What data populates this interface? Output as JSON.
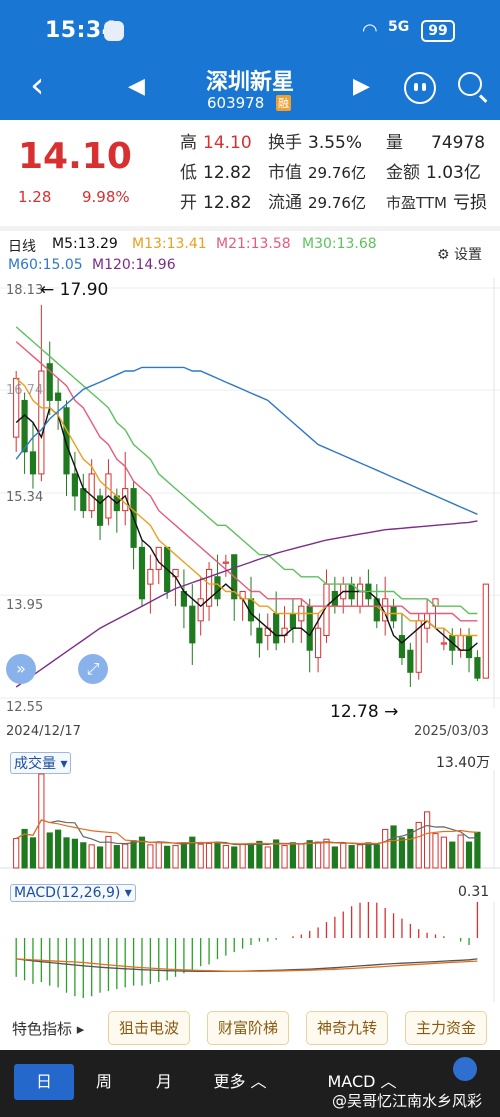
{
  "status": {
    "time": "15:34",
    "signal": "5G",
    "battery": "99"
  },
  "header": {
    "name": "深圳新星",
    "code": "603978",
    "badge": "融"
  },
  "quote": {
    "price": "14.10",
    "change": "1.28",
    "change_pct": "9.98%",
    "rows": [
      [
        {
          "k": "高",
          "v": "14.10"
        },
        {
          "k": "换手",
          "v": "3.55%"
        },
        {
          "k": "量",
          "v": "74978"
        }
      ],
      [
        {
          "k": "低",
          "v": "12.82"
        },
        {
          "k": "市值",
          "v": "29.76亿"
        },
        {
          "k": "金额",
          "v": "1.03亿"
        }
      ],
      [
        {
          "k": "开",
          "v": "12.82"
        },
        {
          "k": "流通",
          "v": "29.76亿"
        },
        {
          "k": "市盈TTM",
          "v": "亏损"
        }
      ]
    ]
  },
  "ma_legend": {
    "period": "日线",
    "ma5": "M5:13.29",
    "ma13": "M13:13.41",
    "ma21": "M21:13.58",
    "ma30": "M30:13.68",
    "ma60": "M60:15.05",
    "ma120": "M120:14.96",
    "settings": "设置",
    "colors": {
      "ma5": "#111111",
      "ma13": "#e8a020",
      "ma21": "#e85a7a",
      "ma30": "#5ec15e",
      "ma60": "#2f78c8",
      "ma120": "#7b2d88"
    }
  },
  "price_axis": {
    "labels": [
      "18.13",
      "15.34",
      "13.95",
      "12.55"
    ],
    "partial": "16.74"
  },
  "dates": {
    "start": "2024/12/17",
    "end": "2025/03/03"
  },
  "annotations": {
    "high": "17.90",
    "low": "12.78"
  },
  "volume": {
    "label": "成交量",
    "max": "13.40万"
  },
  "macd": {
    "label": "MACD(12,26,9)",
    "max": "0.31"
  },
  "features": {
    "label": "特色指标",
    "buttons": [
      "狙击电波",
      "财富阶梯",
      "神奇九转",
      "主力资金"
    ]
  },
  "bottom_tabs": {
    "day": "日",
    "week": "周",
    "month": "月",
    "more": "更多",
    "indicator": "MACD"
  },
  "watermark": "@吴哥忆江南水乡风彩",
  "chart_data": {
    "type": "candlestick",
    "y_range": [
      12.55,
      18.13
    ],
    "candles": [
      {
        "o": 16.1,
        "c": 16.9,
        "h": 17.0,
        "l": 15.9
      },
      {
        "o": 16.6,
        "c": 15.9,
        "h": 16.7,
        "l": 15.6
      },
      {
        "o": 15.9,
        "c": 15.6,
        "h": 16.3,
        "l": 15.4
      },
      {
        "o": 15.6,
        "c": 17.0,
        "h": 17.9,
        "l": 15.5
      },
      {
        "o": 17.1,
        "c": 16.6,
        "h": 17.4,
        "l": 16.4
      },
      {
        "o": 16.7,
        "c": 16.6,
        "h": 16.9,
        "l": 16.2
      },
      {
        "o": 16.5,
        "c": 15.6,
        "h": 16.6,
        "l": 15.3
      },
      {
        "o": 15.6,
        "c": 15.3,
        "h": 15.9,
        "l": 15.1
      },
      {
        "o": 15.4,
        "c": 15.1,
        "h": 15.6,
        "l": 15.0
      },
      {
        "o": 15.1,
        "c": 15.6,
        "h": 15.8,
        "l": 15.0
      },
      {
        "o": 15.3,
        "c": 14.9,
        "h": 15.4,
        "l": 14.7
      },
      {
        "o": 15.0,
        "c": 15.6,
        "h": 15.8,
        "l": 14.9
      },
      {
        "o": 15.3,
        "c": 15.1,
        "h": 15.4,
        "l": 14.8
      },
      {
        "o": 15.1,
        "c": 15.4,
        "h": 15.9,
        "l": 14.9
      },
      {
        "o": 15.4,
        "c": 14.6,
        "h": 15.5,
        "l": 14.3
      },
      {
        "o": 14.6,
        "c": 13.9,
        "h": 14.7,
        "l": 13.8
      },
      {
        "o": 14.1,
        "c": 14.3,
        "h": 14.5,
        "l": 13.7
      },
      {
        "o": 14.3,
        "c": 14.6,
        "h": 14.6,
        "l": 14.1
      },
      {
        "o": 14.6,
        "c": 14.0,
        "h": 14.6,
        "l": 13.9
      },
      {
        "o": 14.2,
        "c": 14.3,
        "h": 14.3,
        "l": 13.8
      },
      {
        "o": 14.0,
        "c": 13.8,
        "h": 14.3,
        "l": 13.5
      },
      {
        "o": 13.8,
        "c": 13.3,
        "h": 14.1,
        "l": 13.0
      },
      {
        "o": 13.6,
        "c": 13.9,
        "h": 14.2,
        "l": 13.4
      },
      {
        "o": 13.8,
        "c": 14.3,
        "h": 14.4,
        "l": 13.6
      },
      {
        "o": 14.2,
        "c": 13.9,
        "h": 14.5,
        "l": 13.8
      },
      {
        "o": 14.4,
        "c": 14.4,
        "h": 14.5,
        "l": 14.2
      },
      {
        "o": 14.5,
        "c": 13.9,
        "h": 14.5,
        "l": 13.6
      },
      {
        "o": 13.9,
        "c": 14.0,
        "h": 14.0,
        "l": 13.6
      },
      {
        "o": 13.9,
        "c": 13.6,
        "h": 14.2,
        "l": 13.4
      },
      {
        "o": 13.5,
        "c": 13.3,
        "h": 13.7,
        "l": 13.1
      },
      {
        "o": 13.4,
        "c": 13.5,
        "h": 13.7,
        "l": 13.2
      },
      {
        "o": 13.7,
        "c": 13.3,
        "h": 14.0,
        "l": 13.2
      },
      {
        "o": 13.4,
        "c": 13.5,
        "h": 13.8,
        "l": 13.3
      },
      {
        "o": 13.7,
        "c": 13.5,
        "h": 13.9,
        "l": 13.3
      },
      {
        "o": 13.6,
        "c": 13.8,
        "h": 13.9,
        "l": 13.3
      },
      {
        "o": 13.8,
        "c": 13.2,
        "h": 13.9,
        "l": 12.9
      },
      {
        "o": 13.1,
        "c": 13.5,
        "h": 13.7,
        "l": 12.9
      },
      {
        "o": 13.4,
        "c": 14.1,
        "h": 14.3,
        "l": 13.3
      },
      {
        "o": 14.0,
        "c": 13.8,
        "h": 14.2,
        "l": 13.7
      },
      {
        "o": 13.9,
        "c": 14.1,
        "h": 14.2,
        "l": 13.7
      },
      {
        "o": 14.1,
        "c": 13.9,
        "h": 14.2,
        "l": 13.8
      },
      {
        "o": 13.8,
        "c": 14.1,
        "h": 14.2,
        "l": 13.7
      },
      {
        "o": 14.1,
        "c": 13.9,
        "h": 14.3,
        "l": 13.8
      },
      {
        "o": 13.9,
        "c": 13.6,
        "h": 14.1,
        "l": 13.5
      },
      {
        "o": 13.6,
        "c": 13.9,
        "h": 14.2,
        "l": 13.4
      },
      {
        "o": 13.8,
        "c": 13.6,
        "h": 13.9,
        "l": 13.5
      },
      {
        "o": 13.4,
        "c": 13.1,
        "h": 13.7,
        "l": 13.0
      },
      {
        "o": 13.2,
        "c": 12.9,
        "h": 13.3,
        "l": 12.7
      },
      {
        "o": 12.9,
        "c": 13.6,
        "h": 13.7,
        "l": 12.8
      },
      {
        "o": 13.5,
        "c": 13.7,
        "h": 13.9,
        "l": 13.3
      },
      {
        "o": 13.8,
        "c": 13.9,
        "h": 13.9,
        "l": 13.5
      },
      {
        "o": 13.3,
        "c": 13.3,
        "h": 13.5,
        "l": 13.2
      },
      {
        "o": 13.4,
        "c": 13.2,
        "h": 13.5,
        "l": 13.0
      },
      {
        "o": 13.2,
        "c": 13.4,
        "h": 13.5,
        "l": 13.1
      },
      {
        "o": 13.4,
        "c": 13.1,
        "h": 13.5,
        "l": 12.9
      },
      {
        "o": 13.1,
        "c": 12.82,
        "h": 13.2,
        "l": 12.78
      },
      {
        "o": 12.82,
        "c": 14.1,
        "h": 14.1,
        "l": 12.82
      }
    ],
    "ma": {
      "ma5": [
        16.3,
        16.4,
        16.3,
        16.1,
        16.5,
        16.4,
        16.0,
        15.7,
        15.4,
        15.3,
        15.2,
        15.3,
        15.2,
        15.3,
        15.0,
        14.7,
        14.6,
        14.4,
        14.3,
        14.2,
        14.0,
        13.9,
        13.8,
        13.9,
        14.0,
        14.1,
        14.0,
        13.9,
        13.7,
        13.6,
        13.5,
        13.4,
        13.4,
        13.5,
        13.5,
        13.4,
        13.6,
        13.8,
        13.9,
        14.0,
        14.0,
        14.0,
        14.0,
        13.9,
        13.7,
        13.4,
        13.3,
        13.4,
        13.5,
        13.6,
        13.5,
        13.4,
        13.3,
        13.2,
        13.2,
        13.3
      ],
      "ma13": [
        16.9,
        16.8,
        16.6,
        16.5,
        16.5,
        16.4,
        16.2,
        16.0,
        15.8,
        15.7,
        15.5,
        15.4,
        15.3,
        15.2,
        15.1,
        15.0,
        14.9,
        14.7,
        14.6,
        14.5,
        14.4,
        14.3,
        14.2,
        14.1,
        14.1,
        14.0,
        14.0,
        13.9,
        13.9,
        13.8,
        13.8,
        13.7,
        13.7,
        13.7,
        13.7,
        13.7,
        13.7,
        13.8,
        13.8,
        13.8,
        13.8,
        13.8,
        13.8,
        13.8,
        13.7,
        13.7,
        13.7,
        13.6,
        13.6,
        13.6,
        13.5,
        13.5,
        13.4,
        13.4,
        13.4,
        13.4
      ],
      "ma21": [
        17.4,
        17.3,
        17.2,
        17.1,
        17.0,
        16.9,
        16.8,
        16.6,
        16.5,
        16.3,
        16.1,
        16.0,
        15.8,
        15.7,
        15.5,
        15.4,
        15.3,
        15.1,
        15.0,
        14.9,
        14.8,
        14.7,
        14.6,
        14.5,
        14.4,
        14.3,
        14.2,
        14.1,
        14.0,
        14.0,
        13.9,
        13.9,
        13.9,
        13.9,
        13.9,
        13.8,
        13.8,
        13.8,
        13.8,
        13.8,
        13.8,
        13.8,
        13.8,
        13.8,
        13.8,
        13.8,
        13.8,
        13.7,
        13.7,
        13.7,
        13.7,
        13.7,
        13.7,
        13.6,
        13.6,
        13.6
      ],
      "ma30": [
        17.6,
        17.5,
        17.4,
        17.3,
        17.2,
        17.1,
        17.0,
        16.9,
        16.8,
        16.7,
        16.6,
        16.5,
        16.3,
        16.2,
        16.0,
        15.9,
        15.8,
        15.6,
        15.5,
        15.4,
        15.3,
        15.2,
        15.1,
        15.0,
        14.9,
        14.9,
        14.8,
        14.7,
        14.6,
        14.5,
        14.5,
        14.4,
        14.3,
        14.3,
        14.2,
        14.2,
        14.2,
        14.1,
        14.1,
        14.1,
        14.1,
        14.0,
        14.0,
        14.0,
        14.0,
        14.0,
        13.9,
        13.9,
        13.9,
        13.9,
        13.8,
        13.8,
        13.8,
        13.8,
        13.7,
        13.7
      ],
      "ma60": [
        15.8,
        15.95,
        16.1,
        16.2,
        16.35,
        16.45,
        16.55,
        16.65,
        16.75,
        16.8,
        16.85,
        16.9,
        16.95,
        17.0,
        17.0,
        17.05,
        17.05,
        17.05,
        17.05,
        17.05,
        17.05,
        17.0,
        17.0,
        16.95,
        16.9,
        16.85,
        16.8,
        16.75,
        16.7,
        16.65,
        16.6,
        16.5,
        16.4,
        16.3,
        16.2,
        16.1,
        16.0,
        15.95,
        15.9,
        15.85,
        15.8,
        15.75,
        15.7,
        15.65,
        15.6,
        15.55,
        15.5,
        15.45,
        15.4,
        15.35,
        15.3,
        15.25,
        15.2,
        15.15,
        15.1,
        15.05
      ],
      "ma120": [
        12.7,
        12.78,
        12.86,
        12.94,
        13.02,
        13.1,
        13.18,
        13.26,
        13.34,
        13.42,
        13.5,
        13.56,
        13.62,
        13.68,
        13.74,
        13.8,
        13.86,
        13.92,
        13.98,
        14.04,
        14.08,
        14.12,
        14.16,
        14.2,
        14.24,
        14.28,
        14.32,
        14.36,
        14.4,
        14.44,
        14.48,
        14.52,
        14.55,
        14.58,
        14.61,
        14.64,
        14.67,
        14.7,
        14.72,
        14.74,
        14.76,
        14.78,
        14.8,
        14.82,
        14.84,
        14.85,
        14.86,
        14.87,
        14.88,
        14.89,
        14.9,
        14.91,
        14.92,
        14.93,
        14.94,
        14.96
      ]
    },
    "volume": [
      4.2,
      5.5,
      4.3,
      13.4,
      5.0,
      5.4,
      4.3,
      4.1,
      3.6,
      3.3,
      3.0,
      4.5,
      3.2,
      3.4,
      3.9,
      4.4,
      3.3,
      3.6,
      3.1,
      3.2,
      3.6,
      4.4,
      3.4,
      3.5,
      3.6,
      3.2,
      3.0,
      3.4,
      3.5,
      3.8,
      3.0,
      4.0,
      3.2,
      3.6,
      3.4,
      3.9,
      3.7,
      4.1,
      3.0,
      3.5,
      3.2,
      3.3,
      3.6,
      3.3,
      5.5,
      6.0,
      4.3,
      5.5,
      6.5,
      8.0,
      4.9,
      4.4,
      3.7,
      4.7,
      3.7,
      5.1
    ],
    "vol_max": 13.4,
    "macd_hist": [
      -0.22,
      -0.24,
      -0.26,
      -0.25,
      -0.27,
      -0.28,
      -0.31,
      -0.33,
      -0.34,
      -0.33,
      -0.31,
      -0.3,
      -0.29,
      -0.28,
      -0.27,
      -0.27,
      -0.26,
      -0.25,
      -0.24,
      -0.22,
      -0.2,
      -0.18,
      -0.16,
      -0.15,
      -0.12,
      -0.1,
      -0.08,
      -0.06,
      -0.04,
      -0.02,
      -0.02,
      -0.01,
      0.0,
      0.01,
      0.02,
      0.04,
      0.06,
      0.09,
      0.12,
      0.15,
      0.18,
      0.2,
      0.22,
      0.2,
      0.17,
      0.14,
      0.11,
      0.08,
      0.05,
      0.03,
      0.02,
      0.01,
      0.0,
      -0.02,
      -0.04,
      0.22
    ]
  }
}
